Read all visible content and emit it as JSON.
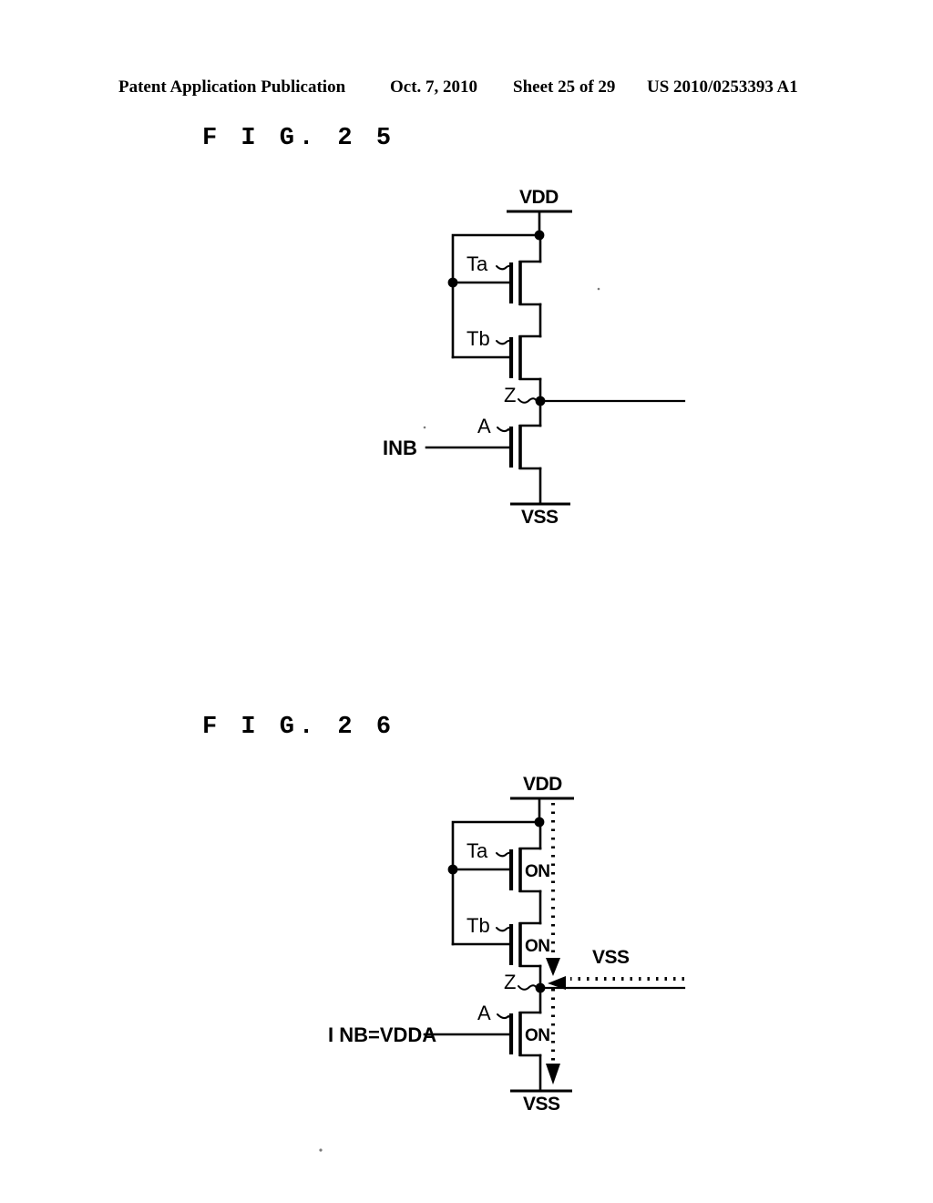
{
  "header": {
    "publication": "Patent Application Publication",
    "date": "Oct. 7, 2010",
    "sheet": "Sheet 25 of 29",
    "patent_number": "US 2010/0253393 A1"
  },
  "figures": [
    {
      "caption": "F I G.  2 5",
      "id": "fig25",
      "labels": {
        "vdd_top": "VDD",
        "vss_bottom": "VSS",
        "transistor_a": "Ta",
        "transistor_b": "Tb",
        "transistor_n": "A",
        "node_out": "Z",
        "input_signal": "INB"
      }
    },
    {
      "caption": "F I G.  2 6",
      "id": "fig26",
      "labels": {
        "vdd_top": "VDD",
        "vss_bottom": "VSS",
        "transistor_a": "Ta",
        "transistor_b": "Tb",
        "transistor_n": "A",
        "node_out": "Z",
        "input_signal": "I NB=VDDA",
        "state_ta": "ON",
        "state_tb": "ON",
        "state_n": "ON",
        "injected_level": "VSS"
      }
    }
  ]
}
